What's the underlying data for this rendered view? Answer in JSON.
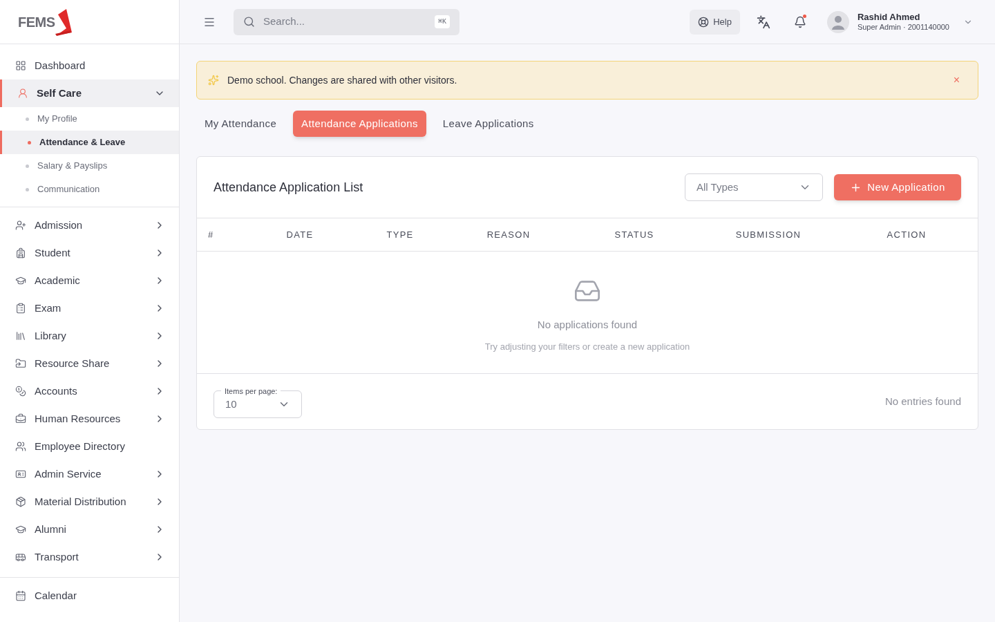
{
  "logo": {
    "text": "FEMS"
  },
  "sidebar": {
    "items": [
      {
        "label": "Dashboard",
        "kind": "link",
        "selected": false
      },
      {
        "label": "Self Care",
        "kind": "group",
        "selected": true,
        "expanded": true,
        "children": [
          {
            "label": "My Profile",
            "selected": false
          },
          {
            "label": "Attendance & Leave",
            "selected": true
          },
          {
            "label": "Salary & Payslips",
            "selected": false
          },
          {
            "label": "Communication",
            "selected": false
          }
        ]
      },
      {
        "label": "Admission",
        "kind": "group",
        "selected": false,
        "expanded": false
      },
      {
        "label": "Student",
        "kind": "group",
        "selected": false,
        "expanded": false
      },
      {
        "label": "Academic",
        "kind": "group",
        "selected": false,
        "expanded": false
      },
      {
        "label": "Exam",
        "kind": "group",
        "selected": false,
        "expanded": false
      },
      {
        "label": "Library",
        "kind": "group",
        "selected": false,
        "expanded": false
      },
      {
        "label": "Resource Share",
        "kind": "group",
        "selected": false,
        "expanded": false
      },
      {
        "label": "Accounts",
        "kind": "group",
        "selected": false,
        "expanded": false
      },
      {
        "label": "Human Resources",
        "kind": "group",
        "selected": false,
        "expanded": false
      },
      {
        "label": "Employee Directory",
        "kind": "link",
        "selected": false
      },
      {
        "label": "Admin Service",
        "kind": "group",
        "selected": false,
        "expanded": false
      },
      {
        "label": "Material Distribution",
        "kind": "group",
        "selected": false,
        "expanded": false
      },
      {
        "label": "Alumni",
        "kind": "group",
        "selected": false,
        "expanded": false
      },
      {
        "label": "Transport",
        "kind": "group",
        "selected": false,
        "expanded": false
      }
    ],
    "footer_items": [
      {
        "label": "Calendar",
        "selected": false
      }
    ]
  },
  "header": {
    "search": {
      "placeholder": "Search...",
      "shortcut": "⌘K"
    },
    "help": "Help",
    "notification_dot": true,
    "user": {
      "name": "Rashid Ahmed",
      "role": "Super Admin · 2001140000"
    }
  },
  "banner": {
    "text": "Demo school. Changes are shared with other visitors.",
    "close": "×"
  },
  "tabs": [
    {
      "label": "My Attendance",
      "selected": false
    },
    {
      "label": "Attendance Applications",
      "selected": true
    },
    {
      "label": "Leave Applications",
      "selected": false
    }
  ],
  "card": {
    "title": "Attendance Application List",
    "filter": {
      "value": "All Types"
    },
    "new_button": "New Application",
    "table": {
      "columns": [
        "#",
        "DATE",
        "TYPE",
        "REASON",
        "STATUS",
        "SUBMISSION",
        "ACTION"
      ]
    },
    "empty": {
      "title": "No applications found",
      "hint": "Try adjusting your filters or create a new application"
    },
    "pagination": {
      "label": "Items per page:",
      "value": "10",
      "summary": "No entries found"
    }
  }
}
